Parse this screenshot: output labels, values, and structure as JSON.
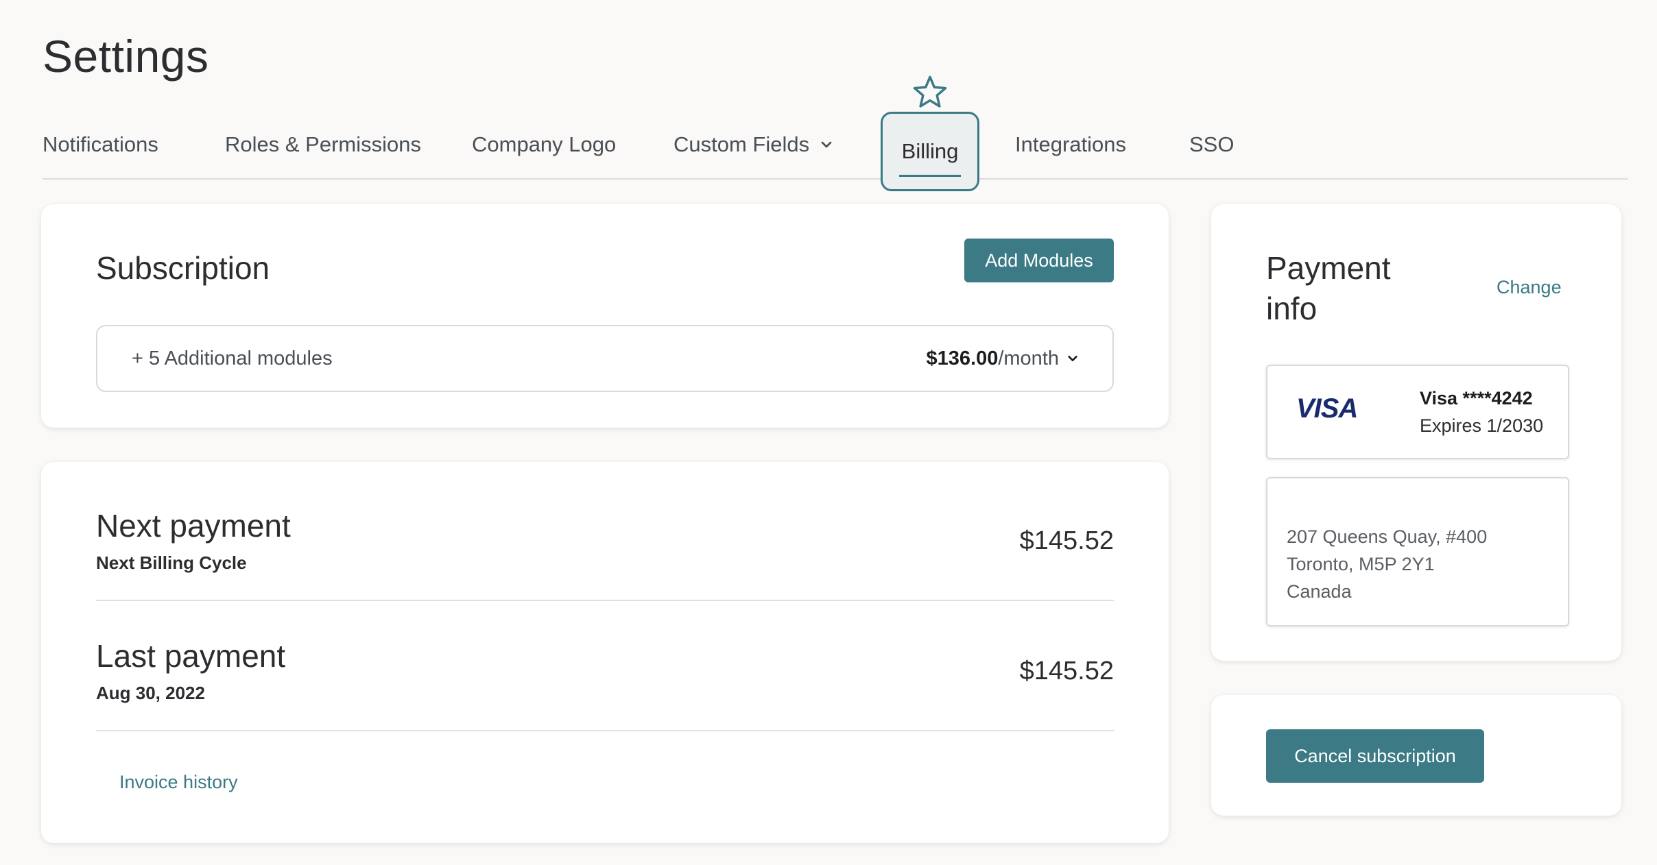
{
  "page": {
    "title": "Settings"
  },
  "tabs": [
    {
      "label": "Notifications"
    },
    {
      "label": "Roles & Permissions"
    },
    {
      "label": "Company Logo"
    },
    {
      "label": "Custom Fields",
      "has_dropdown": true
    },
    {
      "label": "Billing",
      "active": true
    },
    {
      "label": "Integrations"
    },
    {
      "label": "SSO"
    }
  ],
  "subscription": {
    "title": "Subscription",
    "add_button": "Add Modules",
    "modules_label": "+ 5 Additional modules",
    "price": "$136.00",
    "period": "/month"
  },
  "payments": {
    "next": {
      "title": "Next payment",
      "subtitle": "Next Billing Cycle",
      "amount": "$145.52"
    },
    "last": {
      "title": "Last payment",
      "subtitle": "Aug 30, 2022",
      "amount": "$145.52"
    },
    "invoice_link": "Invoice history"
  },
  "payment_info": {
    "title_line1": "Payment",
    "title_line2": "info",
    "change_link": "Change",
    "card_brand": "VISA",
    "card_number": "Visa ****4242",
    "card_expiry": "Expires 1/2030",
    "address": [
      "207 Queens Quay, #400",
      "Toronto, M5P 2Y1",
      "Canada"
    ]
  },
  "cancel": {
    "button": "Cancel subscription"
  },
  "colors": {
    "accent": "#3c7b85",
    "link": "#3a7a84",
    "background": "#faf9f7",
    "visa": "#1a2b6d"
  },
  "icons": {
    "favorite": "star-icon",
    "dropdown": "chevron-down-icon"
  }
}
